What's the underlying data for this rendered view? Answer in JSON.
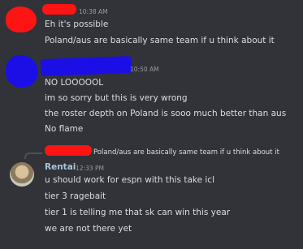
{
  "messages": {
    "group1": {
      "time": "10:38 AM",
      "lines": [
        "Eh it's possible",
        "Poland/aus are basically same team if u think about it"
      ]
    },
    "group2": {
      "time": "10:50 AM",
      "lines": [
        "NO LOOOOOL",
        "im so sorry but this is very wrong",
        "the roster depth on Poland is sooo much better than aus",
        "No flame"
      ]
    },
    "group3": {
      "reply_text": "Poland/aus are basically same team if u think about it",
      "author": "Rentai",
      "time": "12:33 PM",
      "lines": [
        "u should work for espn with this take icl",
        "tier 3 ragebait",
        "tier 1 is telling me that sk can win this year",
        "we are not there yet"
      ]
    }
  },
  "colors": {
    "background": "#313338",
    "text": "#dbdee1",
    "timestamp": "#949ba4",
    "redaction_red": "#ff1414",
    "redaction_blue": "#1c0fe6"
  }
}
